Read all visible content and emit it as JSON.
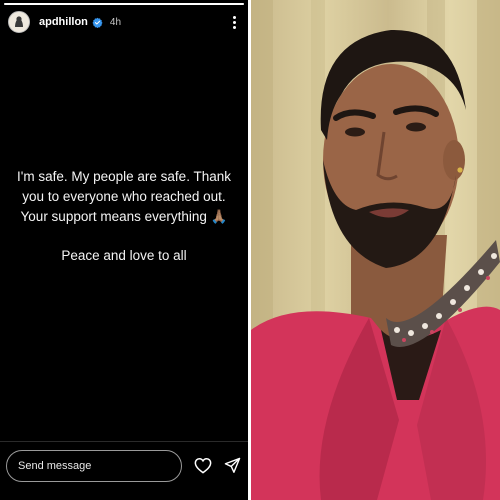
{
  "story": {
    "username": "apdhillon",
    "timestamp": "4h",
    "progress_fraction": 1.0,
    "message_lines": [
      "I'm safe. My people are safe. Thank",
      "you to everyone who reached out.",
      "Your support means everything 🙏🏽"
    ],
    "message_footer": "Peace and love to all",
    "reply_placeholder": "Send message",
    "icons": {
      "verified": "verified-badge-icon",
      "more": "more-options-icon",
      "like": "heart-icon",
      "send": "send-icon"
    },
    "colors": {
      "background": "#000000",
      "text": "#ffffff",
      "verified": "#3897f0"
    }
  },
  "photo": {
    "subject": "portrait photo",
    "colors": {
      "jacket": "#d3345a",
      "background": "#d8cb9c"
    }
  }
}
